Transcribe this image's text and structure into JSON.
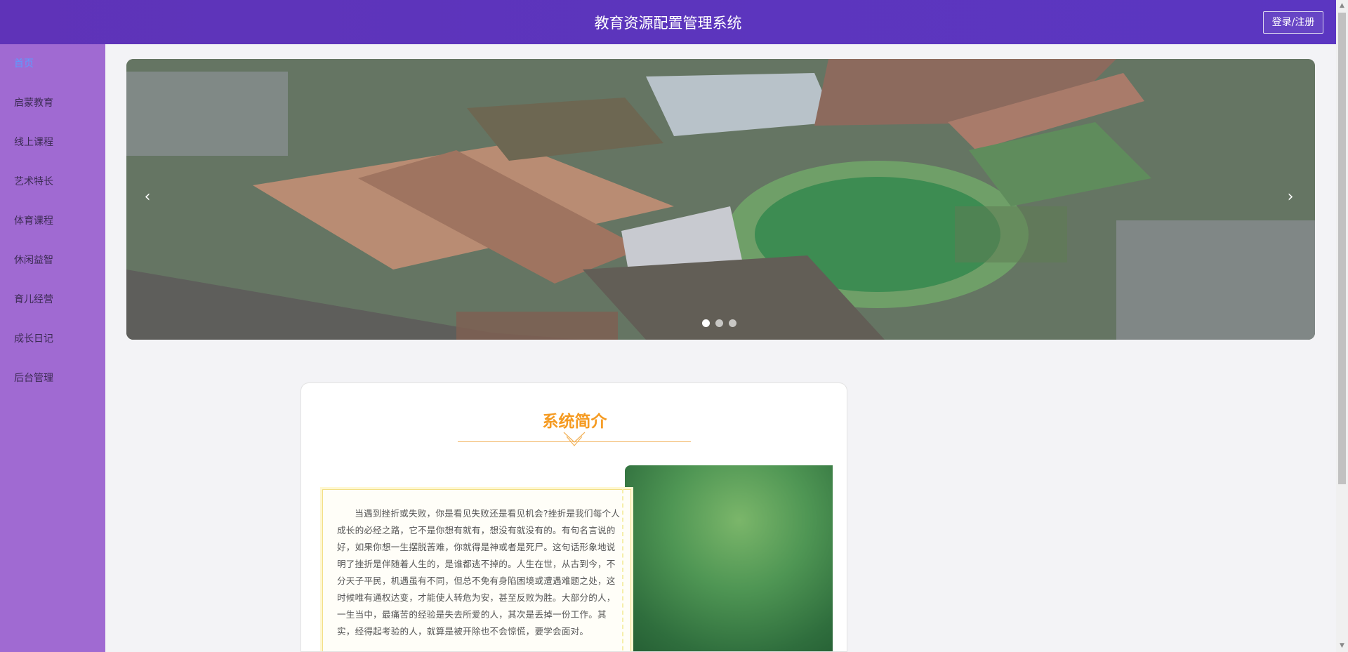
{
  "header": {
    "title": "教育资源配置管理系统",
    "login_label": "登录/注册"
  },
  "sidebar": {
    "items": [
      {
        "label": "首页",
        "active": true
      },
      {
        "label": "启蒙教育",
        "active": false
      },
      {
        "label": "线上课程",
        "active": false
      },
      {
        "label": "艺术特长",
        "active": false
      },
      {
        "label": "体育课程",
        "active": false
      },
      {
        "label": "休闲益智",
        "active": false
      },
      {
        "label": "育儿经营",
        "active": false
      },
      {
        "label": "成长日记",
        "active": false
      },
      {
        "label": "后台管理",
        "active": false
      }
    ]
  },
  "banner": {
    "prev_label": "‹",
    "next_label": "›",
    "slide_count": 3,
    "active_slide": 1
  },
  "intro": {
    "title": "系统简介",
    "body": "当遇到挫折或失败，你是看见失败还是看见机会?挫折是我们每个人成长的必经之路，它不是你想有就有，想没有就没有的。有句名言说的好，如果你想一生摆脱苦难，你就得是神或者是死尸。这句话形象地说明了挫折是伴随着人生的，是谁都逃不掉的。人生在世，从古到今，不分天子平民，机遇虽有不同，但总不免有身陷困境或遭遇难题之处，这时候唯有通权达变，才能使人转危为安，甚至反败为胜。大部分的人，一生当中，最痛苦的经验是失去所爱的人，其次是丢掉一份工作。其实，经得起考验的人，就算是被开除也不会惊慌，要学会面对。"
  },
  "colors": {
    "header": "#5c35bd",
    "sidebar": "#a06ad2",
    "active_nav": "#5d9bff",
    "accent": "#f59a20"
  }
}
